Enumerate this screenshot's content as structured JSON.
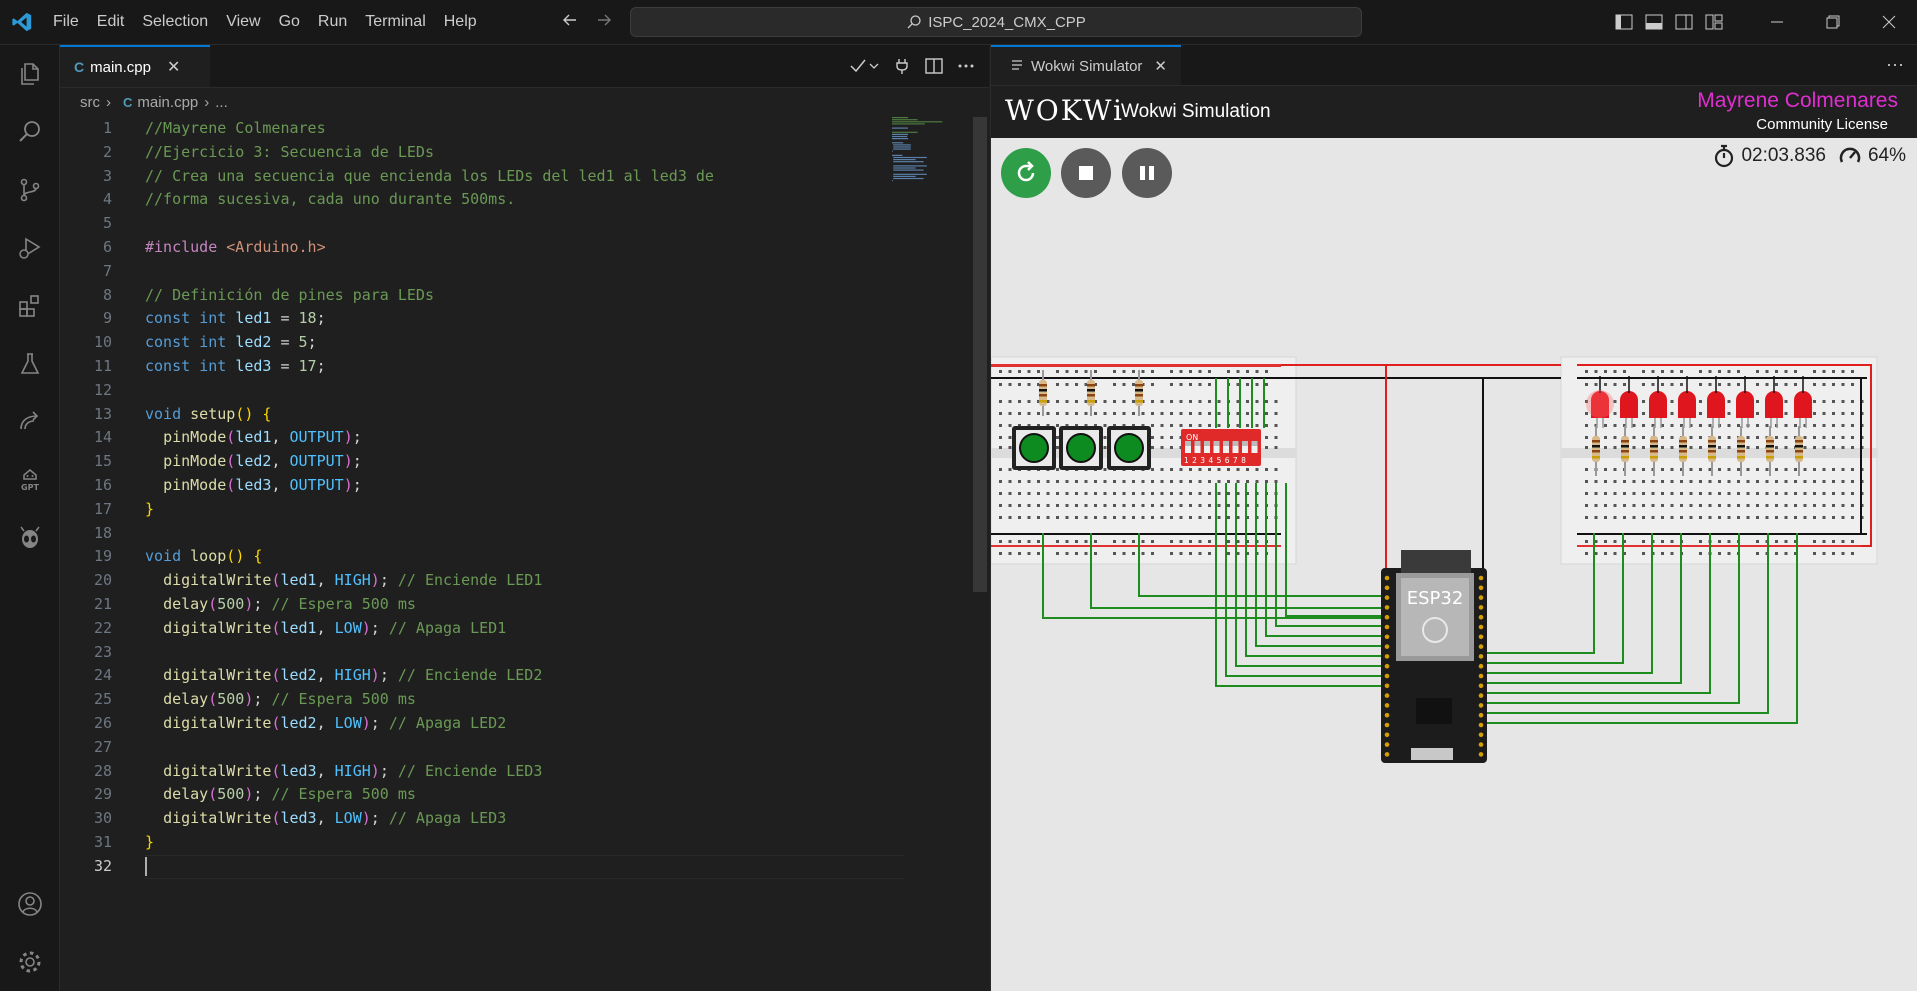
{
  "menu": [
    "File",
    "Edit",
    "Selection",
    "View",
    "Go",
    "Run",
    "Terminal",
    "Help"
  ],
  "search": {
    "label": "ISPC_2024_CMX_CPP"
  },
  "editor": {
    "tab": {
      "icon": "C",
      "label": "main.cpp"
    },
    "breadcrumb": {
      "folder": "src",
      "file": "main.cpp",
      "more": "..."
    },
    "lines": [
      "//Mayrene Colmenares",
      "//Ejercicio 3: Secuencia de LEDs",
      "// Crea una secuencia que encienda los LEDs del led1 al led3 de",
      "//forma sucesiva, cada uno durante 500ms.",
      "",
      "#include <Arduino.h>",
      "",
      "// Definición de pines para LEDs",
      "const int led1 = 18;",
      "const int led2 = 5;",
      "const int led3 = 17;",
      "",
      "void setup() {",
      "  pinMode(led1, OUTPUT);",
      "  pinMode(led2, OUTPUT);",
      "  pinMode(led3, OUTPUT);",
      "}",
      "",
      "void loop() {",
      "  digitalWrite(led1, HIGH); // Enciende LED1",
      "  delay(500); // Espera 500 ms",
      "  digitalWrite(led1, LOW); // Apaga LED1",
      "",
      "  digitalWrite(led2, HIGH); // Enciende LED2",
      "  delay(500); // Espera 500 ms",
      "  digitalWrite(led2, LOW); // Apaga LED2",
      "",
      "  digitalWrite(led3, HIGH); // Enciende LED3",
      "  delay(500); // Espera 500 ms",
      "  digitalWrite(led3, LOW); // Apaga LED3",
      "}",
      ""
    ],
    "line_numbers": [
      "1",
      "2",
      "3",
      "4",
      "5",
      "6",
      "7",
      "8",
      "9",
      "10",
      "11",
      "12",
      "13",
      "14",
      "15",
      "16",
      "17",
      "18",
      "19",
      "20",
      "21",
      "22",
      "23",
      "24",
      "25",
      "26",
      "27",
      "28",
      "29",
      "30",
      "31",
      "32"
    ]
  },
  "simulator": {
    "tab_label": "Wokwi Simulator",
    "logo": "WOKWi",
    "title": "Wokwi Simulation",
    "license_name": "Mayrene Colmenares",
    "license_type": "Community License",
    "timer": "02:03.836",
    "speed": "64%",
    "board_label": "ESP32",
    "dip_label": "ON",
    "dip_numbers": "1 2 3 4 5 6 7 8",
    "colors": {
      "restart": "#2e9e48",
      "stop": "#5a5a5a",
      "pause": "#5a5a5a",
      "wire_green": "#1e8c1e",
      "wire_red": "#e01e1e",
      "led_red": "#e0161f",
      "dip_red": "#e02a2a"
    }
  }
}
